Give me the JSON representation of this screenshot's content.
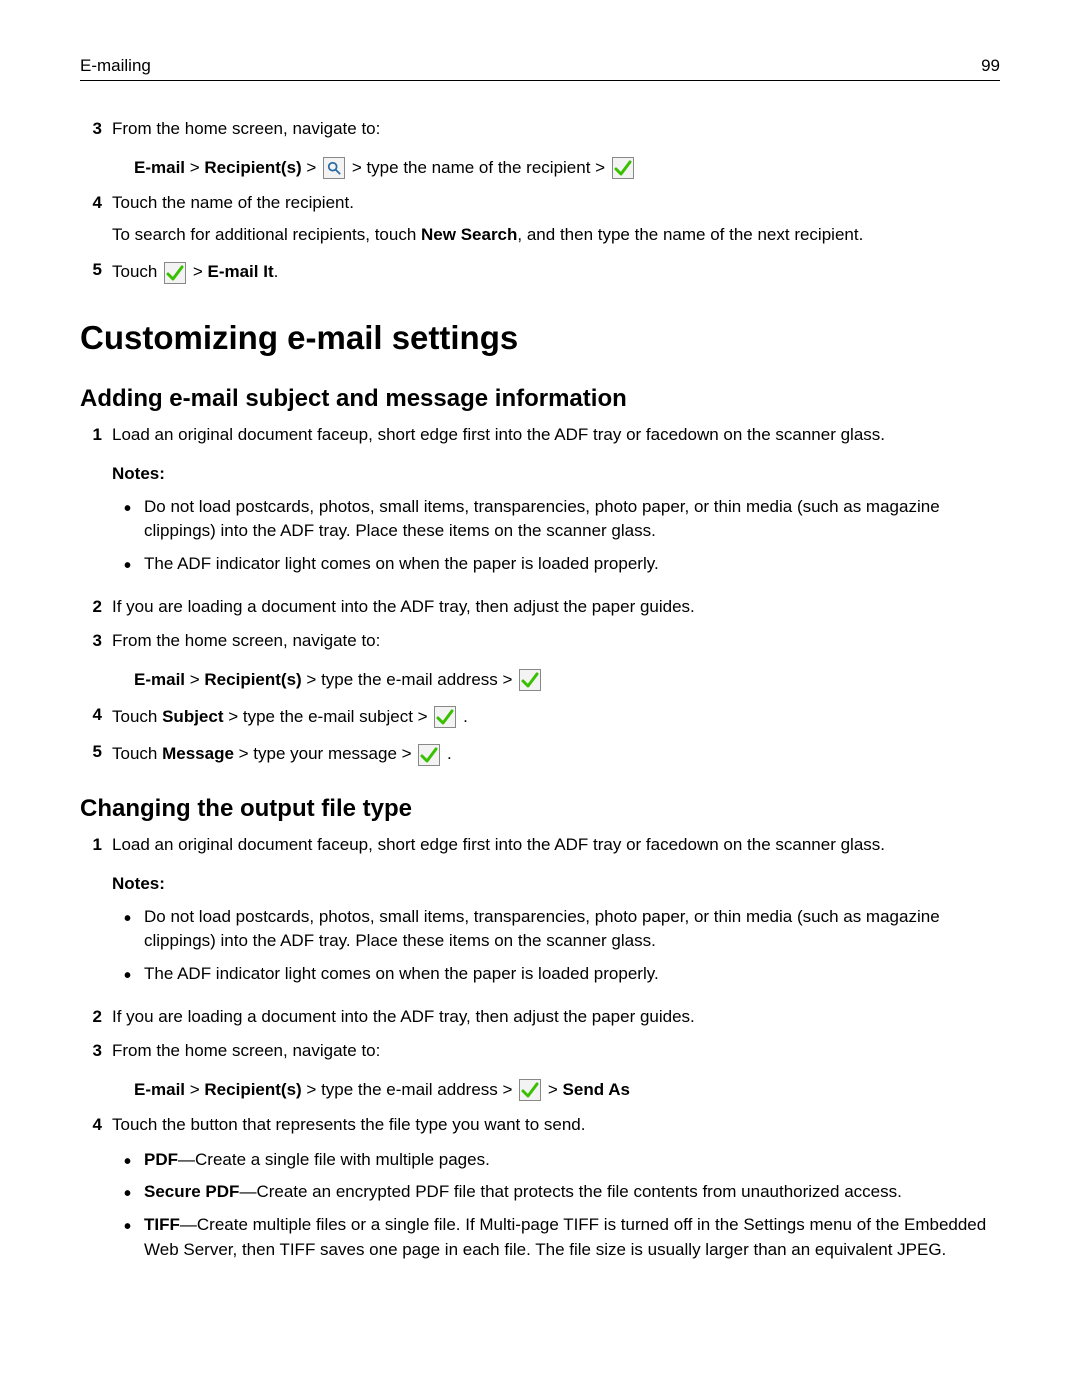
{
  "header": {
    "section": "E-mailing",
    "page": "99"
  },
  "steps_top": {
    "s3": {
      "num": "3",
      "text": "From the home screen, navigate to:",
      "path_a": "E‑mail",
      "sep": " > ",
      "path_b": "Recipient(s)",
      "tail": " > type the name of the recipient > "
    },
    "s4": {
      "num": "4",
      "text": "Touch the name of the recipient.",
      "sub_a": "To search for additional recipients, touch ",
      "sub_bold": "New Search",
      "sub_b": ", and then type the name of the next recipient."
    },
    "s5": {
      "num": "5",
      "pre": "Touch ",
      "sep": " > ",
      "bold": "E‑mail It",
      "post": "."
    }
  },
  "h1": "Customizing e‑mail settings",
  "sectionA": {
    "title": "Adding e‑mail subject and message information",
    "s1": {
      "num": "1",
      "text": "Load an original document faceup, short edge first into the ADF tray or facedown on the scanner glass."
    },
    "notes_label": "Notes:",
    "note1": "Do not load postcards, photos, small items, transparencies, photo paper, or thin media (such as magazine clippings) into the ADF tray. Place these items on the scanner glass.",
    "note2": "The ADF indicator light comes on when the paper is loaded properly.",
    "s2": {
      "num": "2",
      "text": "If you are loading a document into the ADF tray, then adjust the paper guides."
    },
    "s3": {
      "num": "3",
      "text": "From the home screen, navigate to:",
      "path_a": "E‑mail",
      "sep": " > ",
      "path_b": "Recipient(s)",
      "tail": " > type the e‑mail address > "
    },
    "s4": {
      "num": "4",
      "pre": "Touch ",
      "bold": "Subject",
      "mid": " > type the e‑mail subject > "
    },
    "s5": {
      "num": "5",
      "pre": "Touch ",
      "bold": "Message",
      "mid": " > type your message > "
    }
  },
  "sectionB": {
    "title": "Changing the output file type",
    "s1": {
      "num": "1",
      "text": "Load an original document faceup, short edge first into the ADF tray or facedown on the scanner glass."
    },
    "notes_label": "Notes:",
    "note1": "Do not load postcards, photos, small items, transparencies, photo paper, or thin media (such as magazine clippings) into the ADF tray. Place these items on the scanner glass.",
    "note2": "The ADF indicator light comes on when the paper is loaded properly.",
    "s2": {
      "num": "2",
      "text": "If you are loading a document into the ADF tray, then adjust the paper guides."
    },
    "s3": {
      "num": "3",
      "text": "From the home screen, navigate to:",
      "path_a": "E‑mail",
      "sep1": " > ",
      "path_b": "Recipient(s)",
      "tail1": " > type the e‑mail address > ",
      "sep2": " > ",
      "bold_end": "Send As"
    },
    "s4": {
      "num": "4",
      "text": "Touch the button that represents the file type you want to send."
    },
    "ft1": {
      "bold": "PDF",
      "rest": "—Create a single file with multiple pages."
    },
    "ft2": {
      "bold": "Secure PDF",
      "rest": "—Create an encrypted PDF file that protects the file contents from unauthorized access."
    },
    "ft3": {
      "bold": "TIFF",
      "rest": "—Create multiple files or a single file. If Multi-page TIFF is turned off in the Settings menu of the Embedded Web Server, then TIFF saves one page in each file. The file size is usually larger than an equivalent JPEG."
    }
  }
}
